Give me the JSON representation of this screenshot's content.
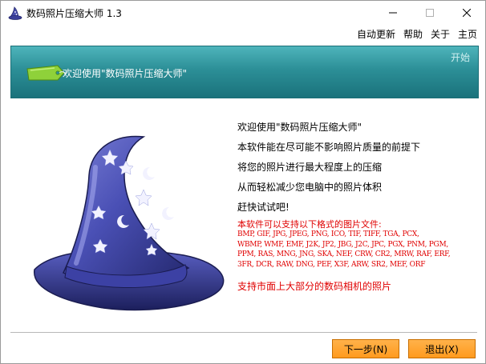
{
  "window": {
    "title": "数码照片压缩大师 1.3"
  },
  "menu": [
    "自动更新",
    "帮助",
    "关于",
    "主页"
  ],
  "banner": {
    "welcome": "欢迎使用\"数码照片压缩大师\"",
    "start": "开始"
  },
  "info": {
    "lines": [
      "欢迎使用\"数码照片压缩大师\"",
      "本软件能在尽可能不影响照片质量的前提下",
      "将您的照片进行最大程度上的压缩",
      "从而轻松减少您电脑中的照片体积",
      "赶快试试吧!"
    ],
    "formats_title": "本软件可以支持以下格式的图片文件:",
    "formats": "BMP, GIF, JPG, JPEG, PNG, ICO, TIF, TIFF, TGA, PCX,\nWBMP, WMF, EMF, J2K, JP2, JBG, J2C, JPC, PGX, PNM, PGM,\nPPM, RAS, MNG, JNG, SKA, NEF, CRW, CR2, MRW, RAF, ERF,\n3FR, DCR, RAW, DNG, PEF, X3F, ARW, SR2, MEF, ORF",
    "camera": "支持市面上大部分的数码相机的照片"
  },
  "buttons": {
    "next": "下一步(N)",
    "exit": "退出(X)"
  },
  "colors": {
    "banner": "#2c8f97",
    "button": "#ff9a1e",
    "highlight_text": "#e00000",
    "hat": "#3b3f9a"
  },
  "icons": {
    "app": "wizard-hat-icon",
    "banner": "price-tag-icon",
    "illustration": "wizard-hat-illustration"
  }
}
